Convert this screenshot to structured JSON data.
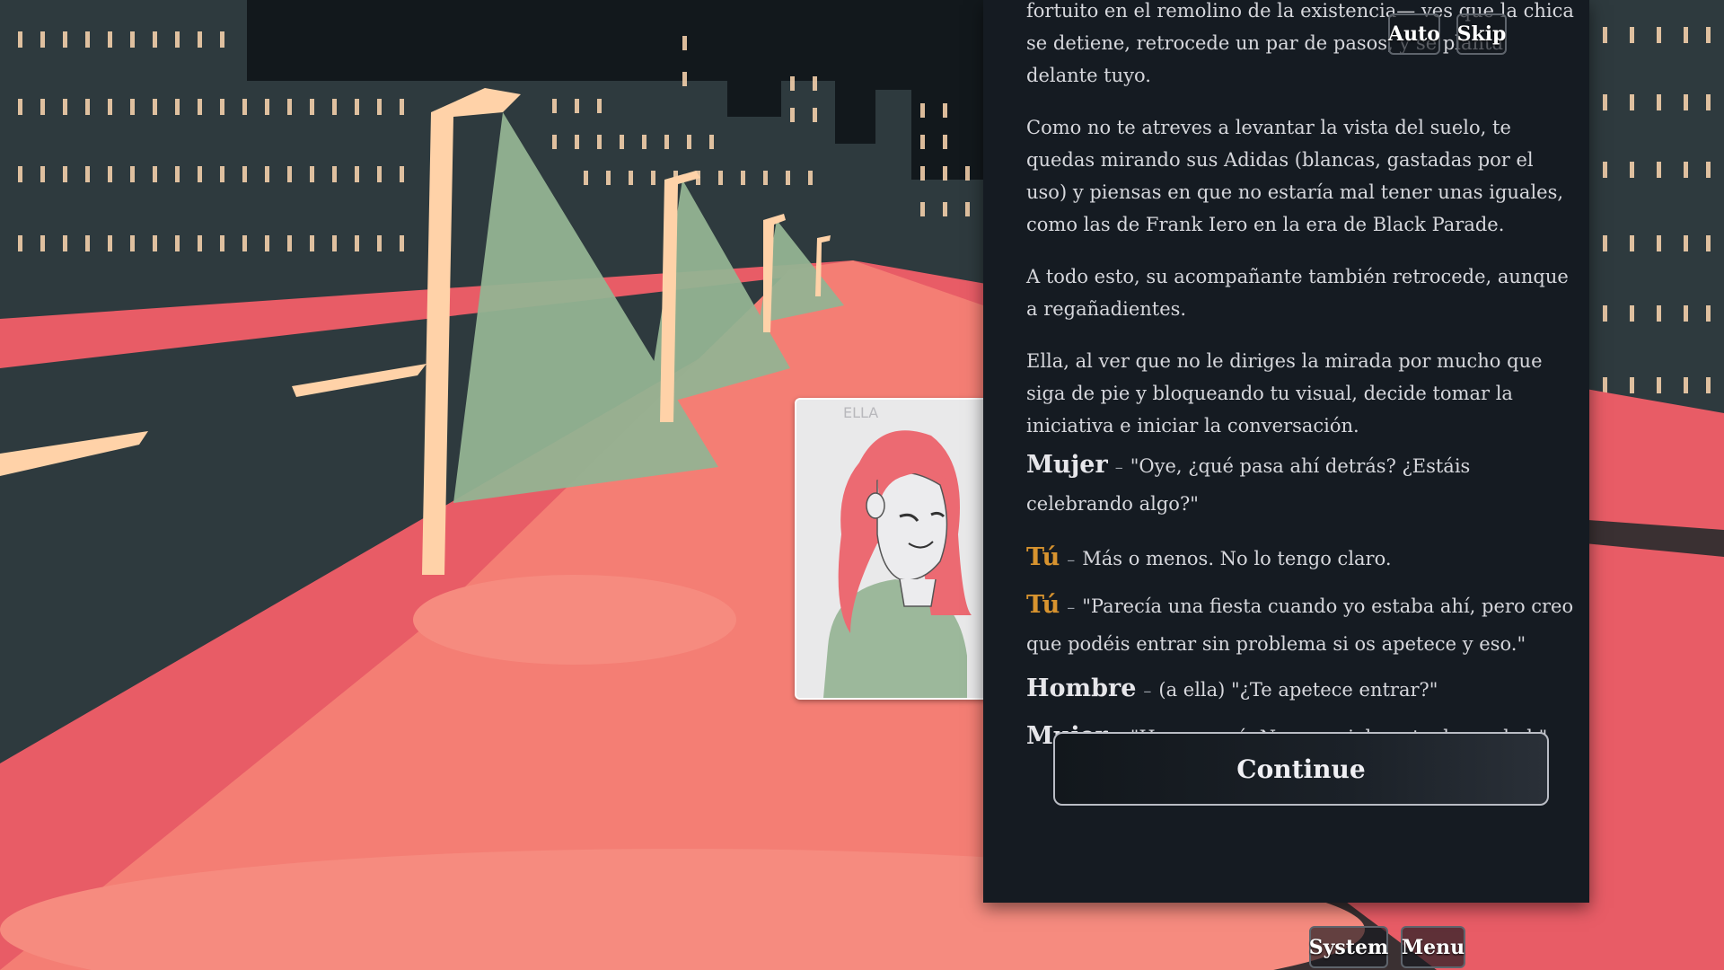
{
  "quick_menu": {
    "auto_label": "Auto",
    "skip_label": "Skip"
  },
  "dialog": {
    "paragraphs": [
      "fortuito en el remolino de la existencia— ves que la chica se detiene, retrocede un par de pasos, y se planta delante tuyo.",
      "Como no te atreves a levantar la vista del suelo, te quedas mirando sus Adidas (blancas, gastadas por el uso) y piensas en que no estaría mal tener unas iguales, como las de Frank Iero en la era de Black Parade.",
      "A todo esto, su acompañante también retrocede, aunque a regañadientes.",
      "Ella, al ver que no le diriges la mirada por mucho que siga de pie y bloqueando tu visual, decide tomar la iniciativa e iniciar la conversación."
    ],
    "lines": [
      {
        "speaker": "Mujer",
        "separator": "–",
        "text": "\"Oye, ¿qué pasa ahí detrás? ¿Estáis celebrando algo?\""
      },
      {
        "speaker": "Tú",
        "separator": "–",
        "text": "Más o menos. No lo tengo claro."
      },
      {
        "speaker": "Tú",
        "separator": "–",
        "text": "\"Parecía una fiesta cuando yo estaba ahí, pero creo que podéis entrar sin problema si os apetece y eso.\""
      },
      {
        "speaker": "Hombre",
        "separator": "–",
        "text": "(a ella) \"¿Te apetece entrar?\""
      },
      {
        "speaker": "Mujer",
        "separator": "–",
        "text": "\"Hm... no sé. No especialmente, la verdad.\""
      }
    ],
    "continue_label": "Continue"
  },
  "bottom_menu": {
    "system_label": "System",
    "menu_label": "Menu"
  },
  "portrait": {
    "caption": "ELLA"
  },
  "colors": {
    "panel_bg": "#151b22",
    "speaker_tu": "#d7932f",
    "speaker_other": "#e6e6ea",
    "road": "#e85c66",
    "sidewalk": "#f47e74",
    "building": "#2e3a3e",
    "lamp_light": "#93b392",
    "lamp_post": "#ffd2a8"
  }
}
